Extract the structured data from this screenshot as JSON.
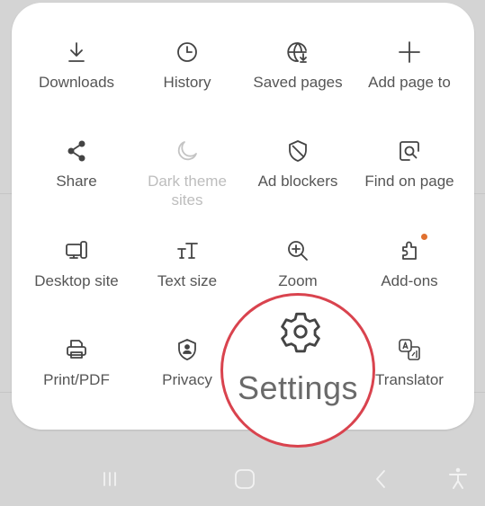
{
  "menu": {
    "items": [
      {
        "label": "Downloads",
        "icon": "download-icon",
        "enabled": true
      },
      {
        "label": "History",
        "icon": "clock-icon",
        "enabled": true
      },
      {
        "label": "Saved pages",
        "icon": "globe-download-icon",
        "enabled": true
      },
      {
        "label": "Add page to",
        "icon": "plus-icon",
        "enabled": true
      },
      {
        "label": "Share",
        "icon": "share-icon",
        "enabled": true
      },
      {
        "label": "Dark theme sites",
        "icon": "moon-icon",
        "enabled": false
      },
      {
        "label": "Ad blockers",
        "icon": "shield-slash-icon",
        "enabled": true
      },
      {
        "label": "Find on page",
        "icon": "find-on-page-icon",
        "enabled": true
      },
      {
        "label": "Desktop site",
        "icon": "desktop-icon",
        "enabled": true
      },
      {
        "label": "Text size",
        "icon": "text-size-icon",
        "enabled": true
      },
      {
        "label": "Zoom",
        "icon": "zoom-in-icon",
        "enabled": true
      },
      {
        "label": "Add-ons",
        "icon": "puzzle-icon",
        "enabled": true,
        "badge": true
      },
      {
        "label": "Print/PDF",
        "icon": "printer-icon",
        "enabled": true
      },
      {
        "label": "Privacy",
        "icon": "privacy-shield-icon",
        "enabled": true
      },
      {
        "label": "Settings",
        "icon": "gear-icon",
        "enabled": true,
        "highlighted": true
      },
      {
        "label": "Translator",
        "icon": "translate-icon",
        "enabled": true
      }
    ]
  },
  "highlight": {
    "label": "Settings",
    "icon": "gear-icon",
    "ring_color": "#d9434e"
  },
  "colors": {
    "badge": "#e0702f",
    "text": "#555555",
    "disabled_text": "#bdbdbd"
  },
  "navbar": {
    "buttons": [
      {
        "name": "recent-apps",
        "icon": "recent-apps-icon"
      },
      {
        "name": "home",
        "icon": "home-icon"
      },
      {
        "name": "back",
        "icon": "back-icon"
      },
      {
        "name": "accessibility",
        "icon": "accessibility-icon"
      }
    ]
  }
}
